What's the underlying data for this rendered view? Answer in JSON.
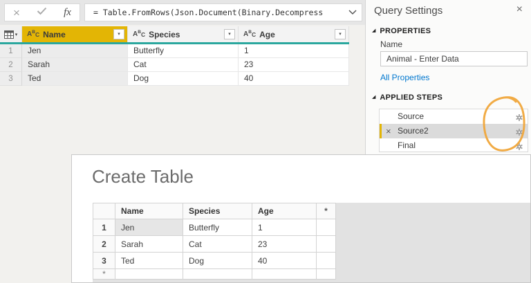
{
  "formula_bar": {
    "formula": "= Table.FromRows(Json.Document(Binary.Decompress",
    "fx_label": "fx"
  },
  "icons": {
    "cancel": "×",
    "close": "×",
    "delete": "×",
    "dropdown": "▾",
    "collapse": "◢",
    "abc_a": "A",
    "abc_b": "B",
    "abc_c": "C"
  },
  "grid": {
    "columns": [
      {
        "name": "Name",
        "selected": true
      },
      {
        "name": "Species",
        "selected": false
      },
      {
        "name": "Age",
        "selected": false
      }
    ],
    "rows": [
      {
        "num": "1",
        "cells": [
          "Jen",
          "Butterfly",
          "1"
        ]
      },
      {
        "num": "2",
        "cells": [
          "Sarah",
          "Cat",
          "23"
        ]
      },
      {
        "num": "3",
        "cells": [
          "Ted",
          "Dog",
          "40"
        ]
      }
    ]
  },
  "query_settings": {
    "title": "Query Settings",
    "properties_header": "PROPERTIES",
    "name_label": "Name",
    "name_value": "Animal - Enter Data",
    "all_properties_link": "All Properties",
    "applied_steps_header": "APPLIED STEPS",
    "steps": [
      {
        "label": "Source",
        "selected": false
      },
      {
        "label": "Source2",
        "selected": true
      },
      {
        "label": "Final",
        "selected": false
      }
    ]
  },
  "dialog": {
    "title": "Create Table",
    "table": {
      "columns": [
        "Name",
        "Species",
        "Age",
        "*"
      ],
      "rows": [
        {
          "num": "1",
          "cells": [
            "Jen",
            "Butterfly",
            "1",
            ""
          ]
        },
        {
          "num": "2",
          "cells": [
            "Sarah",
            "Cat",
            "23",
            ""
          ]
        },
        {
          "num": "3",
          "cells": [
            "Ted",
            "Dog",
            "40",
            ""
          ]
        },
        {
          "num": "*",
          "cells": [
            "",
            "",
            "",
            ""
          ]
        }
      ]
    }
  },
  "colors": {
    "selected_column_yellow": "#E3B505",
    "header_underline_teal": "#2AA79E",
    "selected_step_gray": "#DBDBDB",
    "link_blue": "#0077CF",
    "annotation_circle_orange": "#F0A63B"
  }
}
